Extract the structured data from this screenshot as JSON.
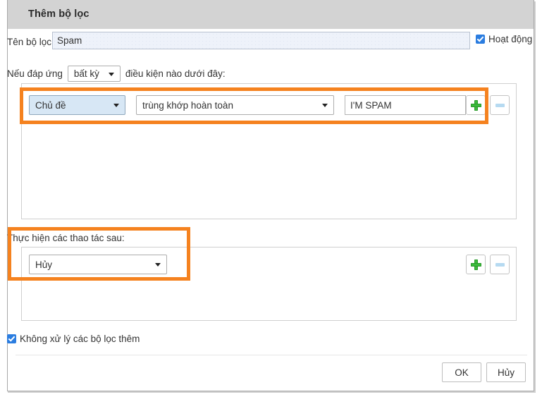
{
  "window": {
    "title": "Thêm bộ lọc"
  },
  "filter_name": {
    "label": "Tên bộ lọc:",
    "value": "Spam",
    "placeholder": ""
  },
  "active_checkbox": {
    "label": "Hoạt động",
    "checked": true
  },
  "match": {
    "prefix": "Nếu đáp ứng",
    "selected": "bất kỳ",
    "suffix": "điều kiện nào dưới đây:"
  },
  "conditions": [
    {
      "field": "Chủ đề",
      "operator": "trùng khớp hoàn toàn",
      "value": "I'M SPAM",
      "add_icon": "plus-icon",
      "remove_icon": "minus-icon"
    }
  ],
  "actions_section": {
    "label": "Thực hiện các thao tác sau:",
    "rows": [
      {
        "action": "Hủy",
        "add_icon": "plus-icon",
        "remove_icon": "minus-icon"
      }
    ]
  },
  "no_further_checkbox": {
    "label": "Không xử lý các bộ lọc thêm",
    "checked": true
  },
  "footer": {
    "ok_label": "OK",
    "cancel_label": "Hủy"
  },
  "colors": {
    "highlight": "#F5821F",
    "titlebar": "#D3D3D3",
    "accent_checkbox": "#2B7DE0",
    "plus_green": "#3CBA3C",
    "field_focus_blue": "#D7E7F5"
  }
}
